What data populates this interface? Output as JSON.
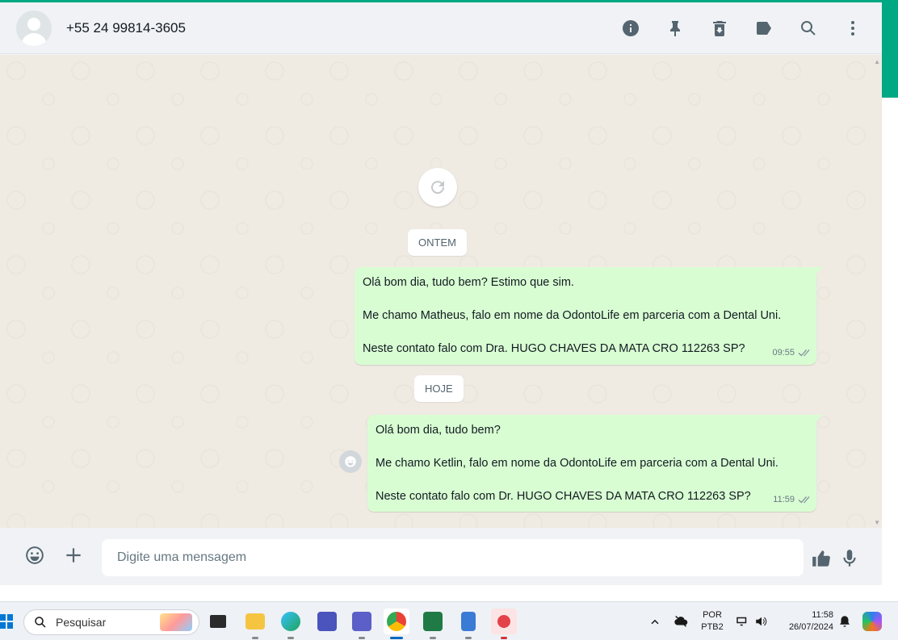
{
  "header": {
    "contact_name": "+55 24 99814-3605",
    "icons": [
      "info-icon",
      "pin-icon",
      "delete-icon",
      "label-icon",
      "search-icon",
      "menu-dots-icon"
    ]
  },
  "chat": {
    "date_chips": [
      "ONTEM",
      "HOJE"
    ],
    "messages": [
      {
        "lines": [
          "Olá bom dia, tudo bem? Estimo que sim.",
          "Me chamo Matheus, falo em nome da OdontoLife em parceria com a Dental Uni.",
          "Neste contato falo com Dra. HUGO CHAVES DA MATA CRO 112263 SP?"
        ],
        "time": "09:55"
      },
      {
        "lines": [
          "Olá bom dia, tudo bem?",
          "Me chamo Ketlin, falo em nome da OdontoLife em parceria com a Dental Uni.",
          "Neste contato falo com Dr. HUGO CHAVES DA MATA CRO 112263 SP?"
        ],
        "time": "11:59"
      }
    ]
  },
  "composer": {
    "placeholder": "Digite uma mensagem"
  },
  "taskbar": {
    "search_label": "Pesquisar",
    "lang_line1": "POR",
    "lang_line2": "PTB2",
    "time": "11:58",
    "date": "26/07/2024"
  },
  "colors": {
    "accent": "#00a884",
    "outgoing_bubble": "#d9fdd3",
    "chat_bg": "#efeae2"
  }
}
